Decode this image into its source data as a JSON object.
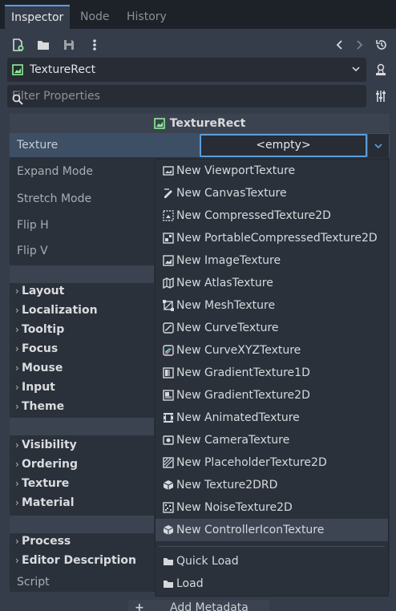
{
  "tabs": [
    {
      "label": "Inspector",
      "active": true
    },
    {
      "label": "Node",
      "active": false
    },
    {
      "label": "History",
      "active": false
    }
  ],
  "toolbar": {
    "icons": [
      "new-resource-icon",
      "open-folder-icon",
      "save-icon",
      "more-vertical-icon",
      "chevron-left-icon",
      "chevron-right-icon",
      "history-icon"
    ]
  },
  "node_selector": {
    "label": "TextureRect"
  },
  "filter": {
    "placeholder": "Filter Properties"
  },
  "class_header": {
    "label": "TextureRect"
  },
  "properties": {
    "texture": {
      "label": "Texture",
      "value": "<empty>"
    },
    "expand_mode": "Expand Mode",
    "stretch_mode": "Stretch Mode",
    "flip_h": "Flip H",
    "flip_v": "Flip V"
  },
  "groups1": [
    "Layout",
    "Localization",
    "Tooltip",
    "Focus",
    "Mouse",
    "Input",
    "Theme"
  ],
  "groups2": [
    "Visibility",
    "Ordering",
    "Texture",
    "Material"
  ],
  "groups3": [
    "Process",
    "Editor Description"
  ],
  "script_label": "Script",
  "add_metadata": "Add Metadata",
  "popup": {
    "items": [
      {
        "label": "New ViewportTexture",
        "icon": "viewport-texture-icon"
      },
      {
        "label": "New CanvasTexture",
        "icon": "canvas-texture-icon"
      },
      {
        "label": "New CompressedTexture2D",
        "icon": "compressed-texture-icon"
      },
      {
        "label": "New PortableCompressedTexture2D",
        "icon": "portable-compressed-texture-icon"
      },
      {
        "label": "New ImageTexture",
        "icon": "image-texture-icon"
      },
      {
        "label": "New AtlasTexture",
        "icon": "atlas-texture-icon"
      },
      {
        "label": "New MeshTexture",
        "icon": "mesh-texture-icon"
      },
      {
        "label": "New CurveTexture",
        "icon": "curve-texture-icon"
      },
      {
        "label": "New CurveXYZTexture",
        "icon": "curve-xyz-texture-icon"
      },
      {
        "label": "New GradientTexture1D",
        "icon": "gradient-texture-1d-icon"
      },
      {
        "label": "New GradientTexture2D",
        "icon": "gradient-texture-2d-icon"
      },
      {
        "label": "New AnimatedTexture",
        "icon": "animated-texture-icon"
      },
      {
        "label": "New CameraTexture",
        "icon": "camera-texture-icon"
      },
      {
        "label": "New PlaceholderTexture2D",
        "icon": "placeholder-texture-icon"
      },
      {
        "label": "New Texture2DRD",
        "icon": "texture-2drd-icon"
      },
      {
        "label": "New NoiseTexture2D",
        "icon": "noise-texture-icon"
      },
      {
        "label": "New ControllerIconTexture",
        "icon": "controller-icon-texture-icon",
        "highlighted": true
      }
    ],
    "actions": [
      {
        "label": "Quick Load",
        "icon": "folder-icon"
      },
      {
        "label": "Load",
        "icon": "folder-icon"
      }
    ]
  },
  "colors": {
    "accent": "#569eff",
    "node_green": "#8eef97",
    "panel": "#363d4a"
  }
}
